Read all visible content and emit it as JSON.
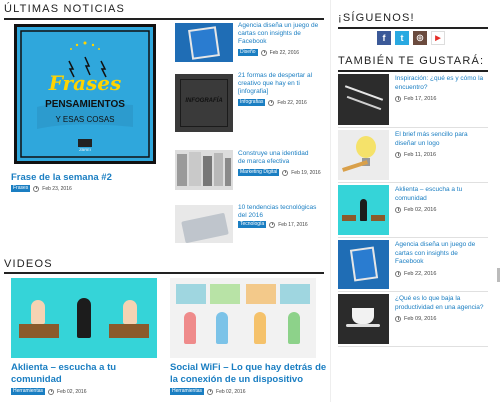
{
  "news": {
    "title": "ÚLTIMAS NOTICIAS",
    "featured": {
      "title": "Frase de la semana #2",
      "tag": "Frases",
      "date": "Feb 23, 2016",
      "image_text": {
        "word1": "Frases",
        "word2": "PENSAMIENTOS",
        "word3": "Y ESAS COSAS",
        "brand": "ZBREI"
      }
    },
    "items": [
      {
        "title_lines": [
          "Agencia diseña un juego de",
          "cartas con insights de",
          "Facebook"
        ],
        "tag": "Diseño",
        "date": "Feb 22, 2016"
      },
      {
        "title_lines": [
          "21 formas de despertar al",
          "creativo que hay en ti",
          "[infografia]"
        ],
        "tag": "Infografias",
        "date": "Feb 22, 2016",
        "image_text": "INFOGRAFÍA"
      },
      {
        "title_lines": [
          "Construye una identidad",
          "de marca efectiva"
        ],
        "tag": "Marketing Digital",
        "date": "Feb 19, 2016"
      },
      {
        "title_lines": [
          "10 tendencias tecnológicas",
          "del 2016"
        ],
        "tag": "Tecnología",
        "date": "Feb 17, 2016"
      }
    ]
  },
  "videos": {
    "title": "VIDEOS",
    "items": [
      {
        "title_lines": [
          "Aklienta – escucha a tu",
          "comunidad"
        ],
        "tag": "Herramientas",
        "date": "Feb 02, 2016"
      },
      {
        "title_lines": [
          "Social WiFi – Lo que hay detrás de",
          "la conexión de un dispositivo"
        ],
        "tag": "Herramientas",
        "date": "Feb 02, 2016"
      }
    ]
  },
  "follow": {
    "title": "¡SÍGUENOS!",
    "icons": [
      {
        "name": "facebook-icon",
        "glyph": "f",
        "color": "#3b5998"
      },
      {
        "name": "twitter-icon",
        "glyph": "t",
        "color": "#29a9e1"
      },
      {
        "name": "instagram-icon",
        "glyph": "◎",
        "color": "#6b4b3e"
      },
      {
        "name": "youtube-icon",
        "glyph": "▶",
        "color": "#ffffff"
      }
    ]
  },
  "related": {
    "title": "TAMBIÉN TE GUSTARÁ:",
    "items": [
      {
        "title_lines": [
          "Inspiración: ¿qué es y cómo la",
          "encuentro?"
        ],
        "date": "Feb 17, 2016"
      },
      {
        "title_lines": [
          "El brief más sencillo para",
          "diseñar un logo"
        ],
        "date": "Feb 11, 2016"
      },
      {
        "title_lines": [
          "Aklienta – escucha a tu",
          "comunidad"
        ],
        "date": "Feb 02, 2016"
      },
      {
        "title_lines": [
          "Agencia diseña un juego de",
          "cartas con insights de",
          "Facebook"
        ],
        "date": "Feb 22, 2016"
      },
      {
        "title_lines": [
          "¿Qué es lo que baja la",
          "productividad en una agencia?"
        ],
        "date": "Feb 09, 2016"
      }
    ]
  },
  "colors": {
    "link": "#1a7ec2",
    "accent": "#2fa7dc",
    "dark": "#222222"
  }
}
